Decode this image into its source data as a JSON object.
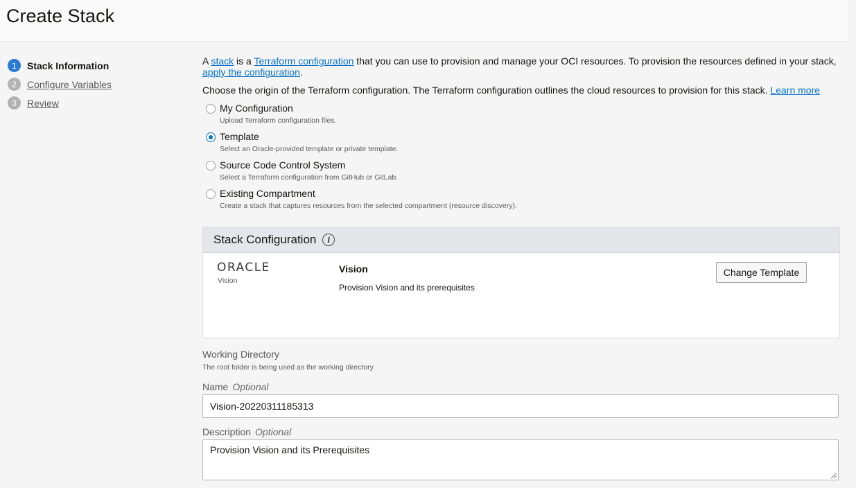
{
  "header": {
    "title": "Create Stack"
  },
  "steps": [
    {
      "num": "1",
      "label": "Stack Information"
    },
    {
      "num": "2",
      "label": "Configure Variables"
    },
    {
      "num": "3",
      "label": "Review"
    }
  ],
  "intro": {
    "a": "A ",
    "stack_link": "stack",
    "is_a": " is a ",
    "tf_link": "Terraform configuration",
    "rest": " that you can use to provision and manage your OCI resources. To provision the resources defined in your stack, ",
    "apply_link": "apply the configuration",
    "end": "."
  },
  "origin": {
    "text": "Choose the origin of the Terraform configuration. The Terraform configuration outlines the cloud resources to provision for this stack. ",
    "learn_more": "Learn more"
  },
  "radios": [
    {
      "title": "My Configuration",
      "desc": "Upload Terraform configuration files."
    },
    {
      "title": "Template",
      "desc": "Select an Oracle-provided template or private template."
    },
    {
      "title": "Source Code Control System",
      "desc": "Select a Terraform configuration from GitHub or GitLab."
    },
    {
      "title": "Existing Compartment",
      "desc": "Create a stack that captures resources from the selected compartment (resource discovery)."
    }
  ],
  "selected_radio": "Template",
  "panel": {
    "title": "Stack Configuration",
    "info_icon": "i",
    "logo": "ORACLE",
    "logo_sub": "Vision",
    "template_name": "Vision",
    "template_desc": "Provision Vision and its prerequisites",
    "change_button": "Change Template"
  },
  "working_dir": {
    "label": "Working Directory",
    "desc": "The root folder is being used as the working directory."
  },
  "name_field": {
    "label": "Name",
    "optional": "Optional",
    "value": "Vision-20220311185313"
  },
  "desc_field": {
    "label": "Description",
    "optional": "Optional",
    "value": "Provision Vision and its Prerequisites"
  },
  "colors": {
    "accent": "#0572ce",
    "step_active": "#2a7ad4",
    "step_inactive": "#b3b3b3"
  }
}
